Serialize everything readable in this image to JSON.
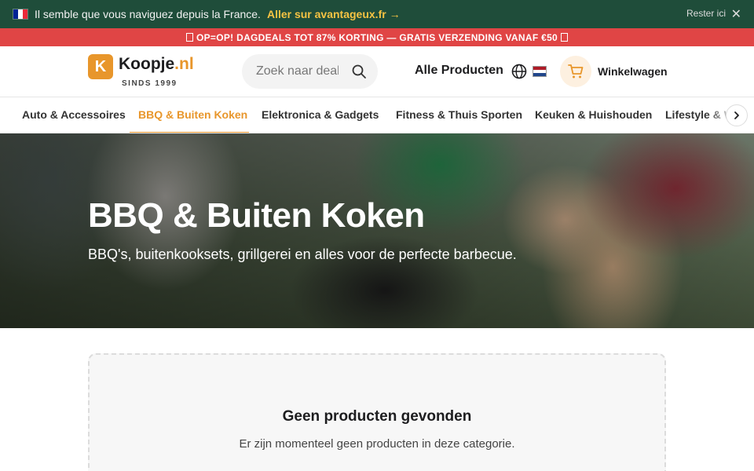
{
  "notice": {
    "message": "Il semble que vous naviguez depuis la France.",
    "redirect_link": "Aller sur avantageux.fr →",
    "stay_label": "Rester ici",
    "close_icon": "close-icon",
    "flag_colors": [
      "#002395",
      "#ffffff",
      "#ed2939"
    ]
  },
  "promo": {
    "text": "OP=OP! DAGDEALS TOT 87% KORTING — GRATIS VERZENDING VANAF €50",
    "icon": "fire-icon"
  },
  "header": {
    "logo_letter": "K",
    "logo_name": "Koopje",
    "logo_tld": ".nl",
    "logo_tagline": "SINDS 1999",
    "search_placeholder": "Zoek naar deals",
    "all_products": "Alle Producten",
    "cart_label": "Winkelwagen",
    "lang_flag_colors": [
      "#ae1c28",
      "#ffffff",
      "#21468b"
    ]
  },
  "categories": [
    {
      "label": "Auto & Accessoires",
      "active": false
    },
    {
      "label": "BBQ & Buiten Koken",
      "active": true
    },
    {
      "label": "Elektronica & Gadgets",
      "active": false
    },
    {
      "label": "Fitness & Thuis Sporten",
      "active": false
    },
    {
      "label": "Keuken & Huishouden",
      "active": false
    },
    {
      "label": "Lifestyle & Wonen",
      "active": false
    }
  ],
  "hero": {
    "title": "BBQ & Buiten Koken",
    "subtitle": "BBQ's, buitenkooksets, grillgerei en alles voor de perfecte barbecue."
  },
  "empty_state": {
    "title": "Geen producten gevonden",
    "message": "Er zijn momenteel geen producten in deze categorie."
  },
  "colors": {
    "accent": "#e8962b",
    "notice_bg": "#1f4d3a",
    "promo_bg": "#e04545"
  }
}
